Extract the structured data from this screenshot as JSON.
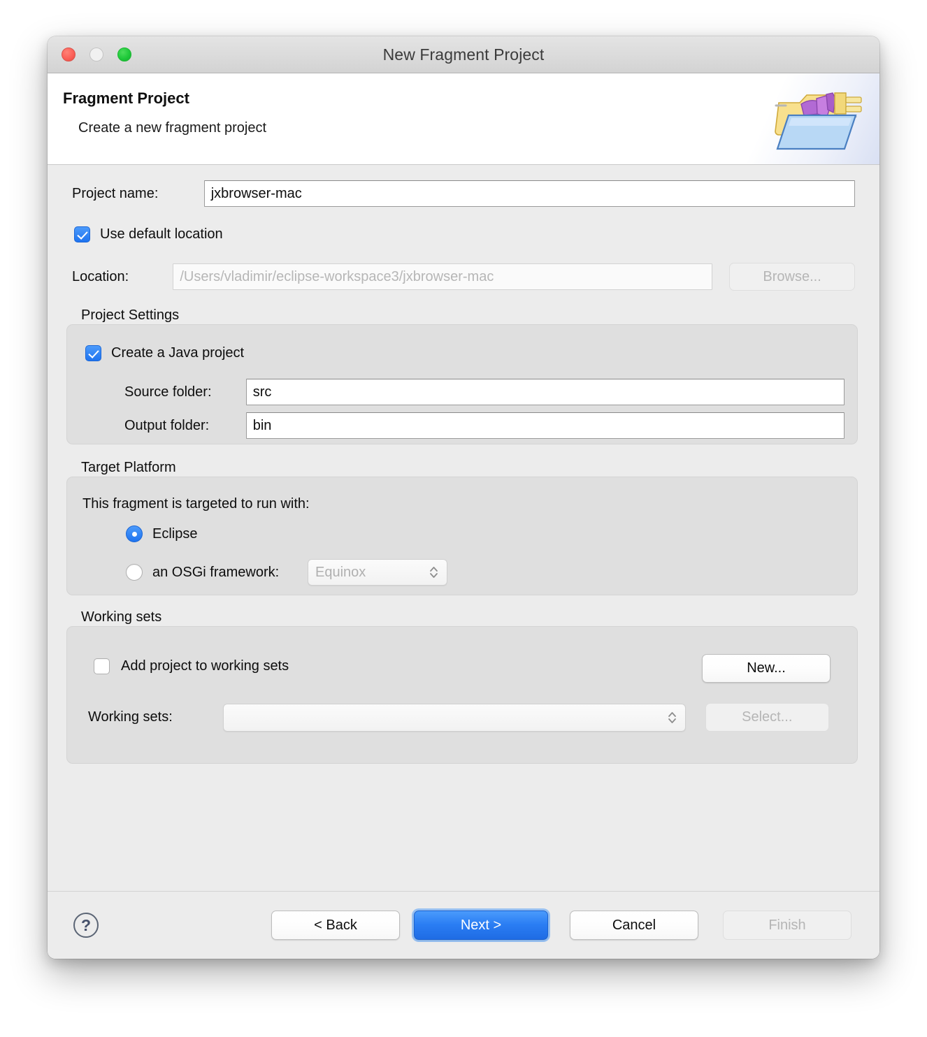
{
  "window": {
    "title": "New Fragment Project",
    "traffic_lights": [
      "close",
      "minimize",
      "zoom"
    ]
  },
  "header": {
    "title": "Fragment Project",
    "subtitle": "Create a new fragment project",
    "icon": "folder-plug-icon"
  },
  "form": {
    "project_name": {
      "label": "Project name:",
      "value": "jxbrowser-mac"
    },
    "use_default_location": {
      "label": "Use default location",
      "checked": true
    },
    "location": {
      "label": "Location:",
      "value": "/Users/vladimir/eclipse-workspace3/jxbrowser-mac",
      "enabled": false
    },
    "browse_button": {
      "label": "Browse...",
      "enabled": false
    }
  },
  "project_settings": {
    "group_label": "Project Settings",
    "create_java_project": {
      "label": "Create a Java project",
      "checked": true
    },
    "source_folder": {
      "label": "Source folder:",
      "value": "src"
    },
    "output_folder": {
      "label": "Output folder:",
      "value": "bin"
    }
  },
  "target_platform": {
    "group_label": "Target Platform",
    "prompt": "This fragment is targeted to run with:",
    "options": [
      {
        "label": "Eclipse",
        "selected": true
      },
      {
        "label": "an OSGi framework:",
        "selected": false
      }
    ],
    "framework_combo": {
      "value": "Equinox",
      "enabled": false
    }
  },
  "working_sets": {
    "group_label": "Working sets",
    "add_to_working_sets": {
      "label": "Add project to working sets",
      "checked": false
    },
    "new_button": {
      "label": "New...",
      "enabled": true
    },
    "working_sets_field": {
      "label": "Working sets:",
      "value": ""
    },
    "select_button": {
      "label": "Select...",
      "enabled": false
    }
  },
  "footer": {
    "help_icon": "question-mark-icon",
    "buttons": [
      {
        "label": "< Back",
        "style": "normal",
        "enabled": true
      },
      {
        "label": "Next >",
        "style": "primary",
        "enabled": true
      },
      {
        "label": "Cancel",
        "style": "normal",
        "enabled": true
      },
      {
        "label": "Finish",
        "style": "normal",
        "enabled": false
      }
    ]
  },
  "colors": {
    "accent": "#2a7df3",
    "dialog_bg": "#ececec",
    "group_bg": "#dfdfdf",
    "text": "#0d0d0d",
    "disabled_text": "#b5b5b5"
  }
}
